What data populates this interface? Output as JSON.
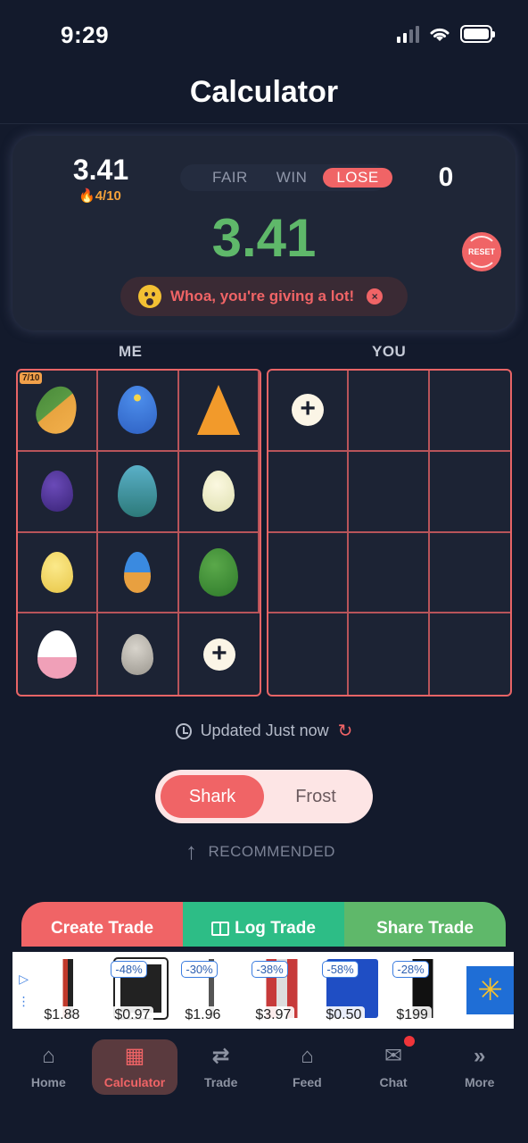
{
  "status_bar": {
    "time": "9:29"
  },
  "header": {
    "title": "Calculator"
  },
  "summary": {
    "me_total": "3.41",
    "me_count": "4/10",
    "you_total": "0",
    "verdict_tabs": [
      "FAIR",
      "WIN",
      "LOSE"
    ],
    "active_verdict": "LOSE",
    "difference": "3.41",
    "reset_label": "RESET",
    "warning": "Whoa, you're giving a lot!"
  },
  "sides": {
    "me_label": "ME",
    "you_label": "YOU"
  },
  "me_grid": {
    "badge": "7/10",
    "items": [
      "orange-green-egg",
      "blue-star-egg",
      "paw-cone-pet",
      "purple-egg",
      "teal-scale-egg",
      "nest-egg",
      "yellow-spotted-egg",
      "rocket-egg",
      "cactus-egg",
      "flower-egg",
      "grey-egg"
    ]
  },
  "updated": {
    "text": "Updated Just now"
  },
  "mode_toggle": {
    "options": [
      "Shark",
      "Frost"
    ],
    "active": "Shark"
  },
  "recommended": "RECOMMENDED",
  "actions": {
    "create": "Create Trade",
    "log": "Log Trade",
    "share": "Share Trade"
  },
  "ad": {
    "items": [
      {
        "discount": "",
        "price": "$1.88"
      },
      {
        "discount": "-48%",
        "price": "$0.97"
      },
      {
        "discount": "-30%",
        "price": "$1.96"
      },
      {
        "discount": "-38%",
        "price": "$3.97"
      },
      {
        "discount": "-58%",
        "price": "$0.50"
      },
      {
        "discount": "-28%",
        "price": "$199"
      }
    ]
  },
  "nav": {
    "items": [
      "Home",
      "Calculator",
      "Trade",
      "Feed",
      "Chat",
      "More"
    ],
    "active": "Calculator"
  },
  "colors": {
    "background": "#131a2c",
    "accent_red": "#f06466",
    "green": "#5fb86a",
    "teal": "#2dbd86",
    "orange": "#f4a23a"
  }
}
